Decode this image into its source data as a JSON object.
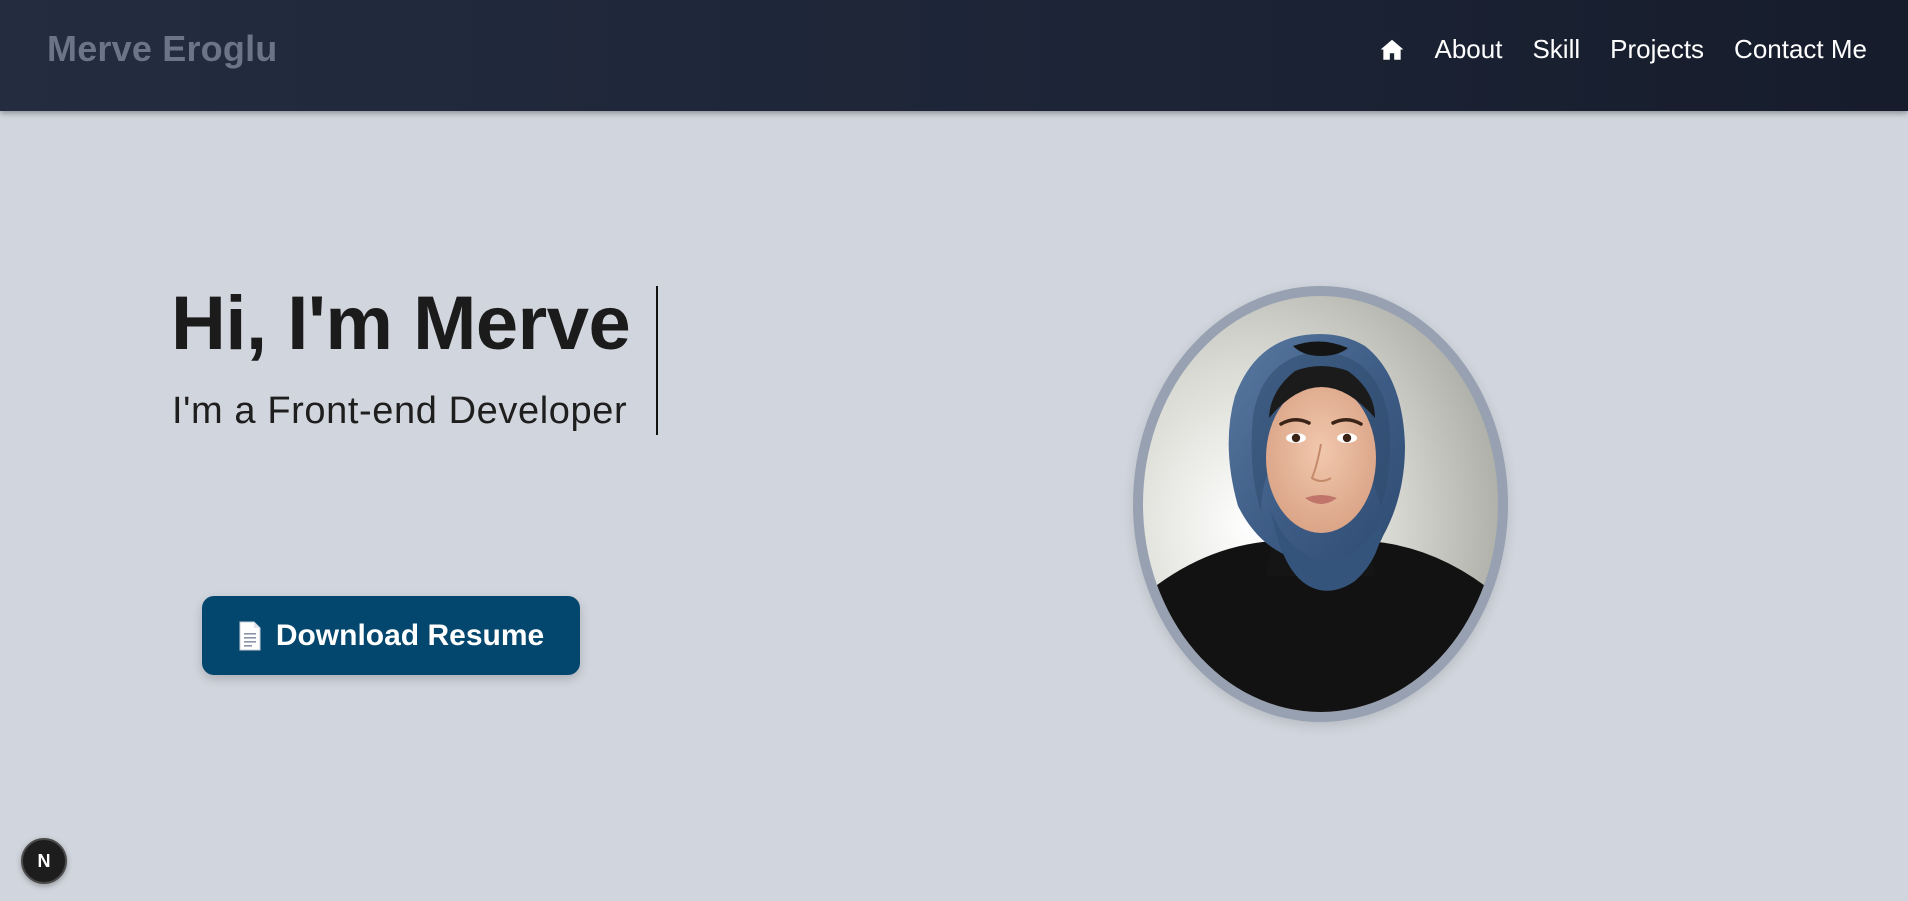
{
  "navbar": {
    "brand": "Merve Eroglu",
    "links": [
      {
        "id": "home",
        "icon": "home-icon"
      },
      {
        "id": "about",
        "label": "About"
      },
      {
        "id": "skill",
        "label": "Skill"
      },
      {
        "id": "projects",
        "label": "Projects"
      },
      {
        "id": "contact",
        "label": "Contact Me"
      }
    ]
  },
  "hero": {
    "title": "Hi, I'm Merve",
    "subtitle": "I'm a Front-end Developer",
    "download_button": {
      "icon": "document-icon",
      "label": "Download Resume"
    }
  },
  "profile_photo": {
    "icon": "profile-photo"
  },
  "dev_badge": {
    "label": "N"
  },
  "colors": {
    "navbar_bg": "#1c2436",
    "brand_text": "#6b7585",
    "page_bg": "#d1d5dd",
    "button_bg": "#04476e",
    "photo_border": "#97a1b1"
  }
}
